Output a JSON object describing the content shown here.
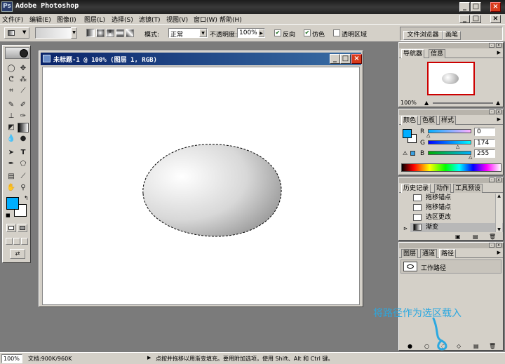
{
  "app": {
    "title": "Adobe Photoshop"
  },
  "menu": [
    "文件(F)",
    "编辑(E)",
    "图像(I)",
    "图层(L)",
    "选择(S)",
    "滤镜(T)",
    "视图(V)",
    "窗口(W)",
    "帮助(H)"
  ],
  "options": {
    "mode_label": "模式:",
    "mode_value": "正常",
    "opacity_label": "不透明度:",
    "opacity_value": "100%",
    "reverse_label": "反向",
    "dither_label": "仿色",
    "transparency_label": "透明区域",
    "reverse_checked": true,
    "dither_checked": true,
    "transparency_checked": false
  },
  "palette_well": {
    "file_browser": "文件浏览器",
    "brushes": "画笔"
  },
  "document": {
    "title": "未标题-1 @ 100% (图层 1, RGB)"
  },
  "navigator": {
    "tabs": [
      "导航器",
      "信息"
    ],
    "zoom": "100%"
  },
  "color": {
    "tabs": [
      "颜色",
      "色板",
      "样式"
    ],
    "r_label": "R",
    "g_label": "G",
    "b_label": "B",
    "r_value": "0",
    "g_value": "174",
    "b_value": "255",
    "foreground": "#00aeff",
    "background": "#ffffff"
  },
  "history": {
    "tabs": [
      "历史记录",
      "动作",
      "工具预设"
    ],
    "items": [
      "拖移锚点",
      "拖移锚点",
      "选区更改",
      "渐变"
    ]
  },
  "paths": {
    "tabs": [
      "图层",
      "通道",
      "路径"
    ],
    "items": [
      "工作路径"
    ]
  },
  "annotation": "将路径作为选区载入",
  "status": {
    "zoom": "100%",
    "doc": "文档:900K/960K",
    "hint": "点按并拖移以用渐变填充。要用附加选项，使用 Shift、Alt 和 Ctrl 键。"
  }
}
